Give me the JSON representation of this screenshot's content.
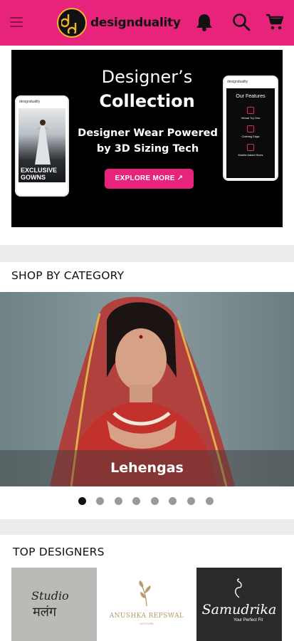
{
  "header": {
    "brand": "designduality",
    "colors": {
      "accent": "#e8237c",
      "logo_ring": "#f2b52a"
    },
    "icons": [
      "menu-icon",
      "bell-icon",
      "search-icon",
      "cart-icon"
    ]
  },
  "banner": {
    "title_line1": "Designer’s",
    "title_line2": "Collection",
    "subtitle": "Designer Wear Powered by 3D Sizing Tech",
    "cta_label": "EXPLORE MORE ↗",
    "left_phone": {
      "brand": "designduality",
      "label": "EXCLUSIVE GOWNS"
    },
    "right_phone": {
      "brand": "designduality",
      "title": "Our Features",
      "features": [
        "Virtual Try-Ons",
        "Clothing Edge",
        "Mobile-based Sizes"
      ]
    }
  },
  "shop_by_category": {
    "title": "SHOP BY CATEGORY",
    "current_item": "Lehengas",
    "carousel": {
      "total": 8,
      "active_index": 0
    }
  },
  "top_designers": {
    "title": "TOP DESIGNERS",
    "items": [
      {
        "line1": "Studio",
        "line2": "मलंग"
      },
      {
        "line1": "ANUSHKA REPSWAL",
        "line2": "COUTURE"
      },
      {
        "line1": "Samudrika",
        "line2": "Your Perfect Fit"
      }
    ]
  }
}
